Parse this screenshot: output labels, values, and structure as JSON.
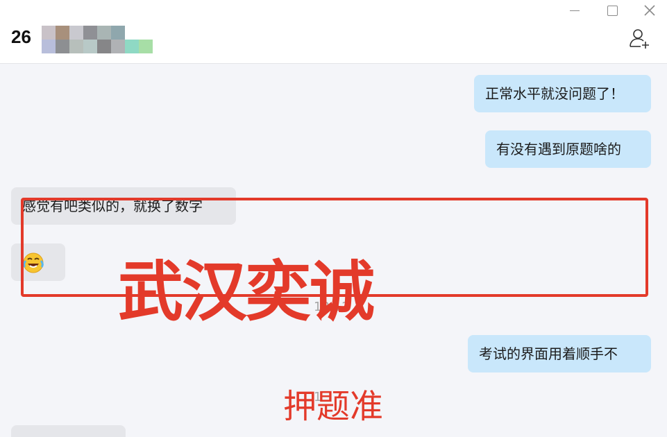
{
  "header": {
    "title_visible": "26",
    "add_member_icon": "add-person-icon"
  },
  "window_controls": [
    "minimize-icon",
    "maximize-icon",
    "close-icon"
  ],
  "messages": [
    {
      "direction": "out",
      "text": "正常水平就没问题了！"
    },
    {
      "direction": "out",
      "text": "有没有遇到原题啥的"
    },
    {
      "direction": "in",
      "text": "感觉有吧类似的，就换了数字"
    },
    {
      "direction": "in",
      "emoji": "laughing-crying-emoji"
    },
    {
      "direction": "out",
      "text": "考试的界面用着顺手不"
    }
  ],
  "timestamp": "13:12",
  "timestamp_partial": "1",
  "overlay": {
    "big_text": "武汉奕诚",
    "small_text": "押题准",
    "accent_color": "#e33a2a"
  },
  "colors": {
    "outgoing_bubble": "#c9e7fb",
    "incoming_bubble": "#e5e6ea",
    "background": "#f4f5f9"
  }
}
